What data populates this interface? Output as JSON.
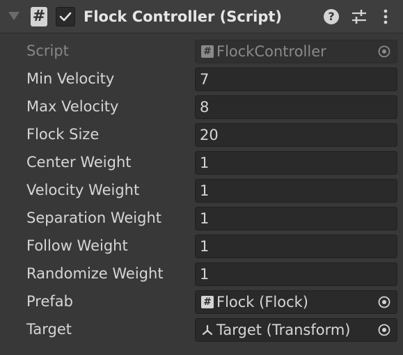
{
  "header": {
    "title": "Flock Controller (Script)",
    "script_icon_glyph": "#",
    "enabled": true,
    "help_glyph": "?"
  },
  "icons": {
    "foldout": "foldout-arrow-icon",
    "script": "csharp-script-icon",
    "toggle": "checkmark-icon",
    "help": "help-icon",
    "presets": "presets-sliders-icon",
    "menu": "kebab-menu-icon",
    "object_picker": "object-picker-icon",
    "transform": "transform-icon"
  },
  "fields": {
    "script": {
      "label": "Script",
      "value": "FlockController",
      "glyph": "#"
    },
    "min_velocity": {
      "label": "Min Velocity",
      "value": "7"
    },
    "max_velocity": {
      "label": "Max Velocity",
      "value": "8"
    },
    "flock_size": {
      "label": "Flock Size",
      "value": "20"
    },
    "center_weight": {
      "label": "Center Weight",
      "value": "1"
    },
    "velocity_weight": {
      "label": "Velocity Weight",
      "value": "1"
    },
    "separation_weight": {
      "label": "Separation Weight",
      "value": "1"
    },
    "follow_weight": {
      "label": "Follow Weight",
      "value": "1"
    },
    "randomize_weight": {
      "label": "Randomize Weight",
      "value": "1"
    },
    "prefab": {
      "label": "Prefab",
      "value": "Flock (Flock)",
      "glyph": "#"
    },
    "target": {
      "label": "Target",
      "value": "Target (Transform)"
    }
  },
  "colors": {
    "background": "#383838",
    "header": "#3e3e3e",
    "field": "#2a2a2a",
    "text": "#d6d6d6",
    "disabled_text": "#878787"
  }
}
